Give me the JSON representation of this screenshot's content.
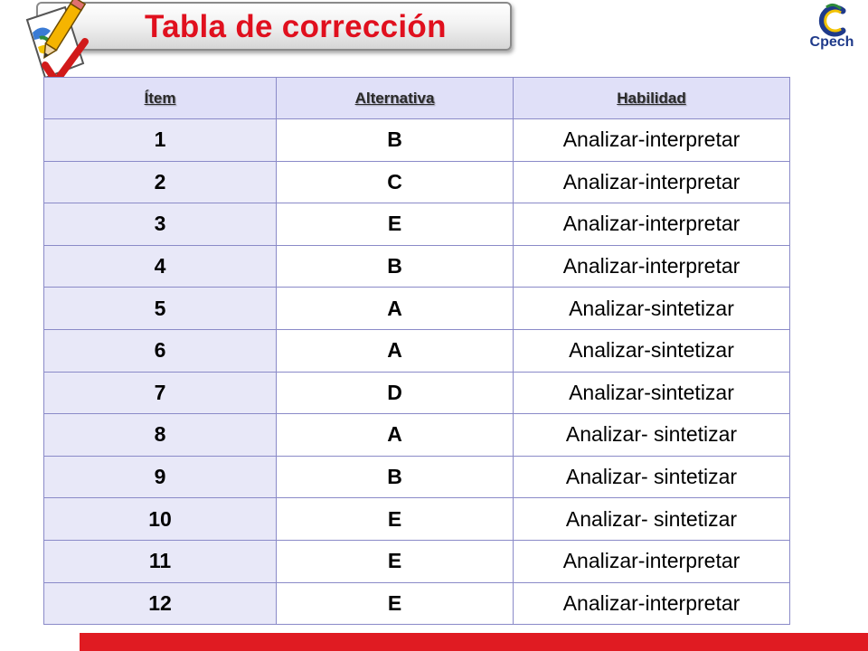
{
  "slide": {
    "title": "Tabla de corrección",
    "logo_text": "Cpech"
  },
  "colors": {
    "title_red": "#e0101e",
    "bottom_bar": "#e01b22",
    "header_fill": "#e0e0f8",
    "first_col_fill": "#e8e8f8",
    "border": "#8a8ac8"
  },
  "icons": {
    "illustration": "pencil-and-check-icon",
    "logo": "cpech-logo"
  },
  "table": {
    "headers": [
      "Ítem",
      "Alternativa",
      "Habilidad"
    ],
    "rows": [
      {
        "item": "1",
        "alt": "B",
        "hab": "Analizar-interpretar"
      },
      {
        "item": "2",
        "alt": "C",
        "hab": "Analizar-interpretar"
      },
      {
        "item": "3",
        "alt": "E",
        "hab": "Analizar-interpretar"
      },
      {
        "item": "4",
        "alt": "B",
        "hab": "Analizar-interpretar"
      },
      {
        "item": "5",
        "alt": "A",
        "hab": "Analizar-sintetizar"
      },
      {
        "item": "6",
        "alt": "A",
        "hab": "Analizar-sintetizar"
      },
      {
        "item": "7",
        "alt": "D",
        "hab": "Analizar-sintetizar"
      },
      {
        "item": "8",
        "alt": "A",
        "hab": "Analizar- sintetizar"
      },
      {
        "item": "9",
        "alt": "B",
        "hab": "Analizar- sintetizar"
      },
      {
        "item": "10",
        "alt": "E",
        "hab": "Analizar- sintetizar"
      },
      {
        "item": "11",
        "alt": "E",
        "hab": "Analizar-interpretar"
      },
      {
        "item": "12",
        "alt": "E",
        "hab": "Analizar-interpretar"
      }
    ]
  }
}
